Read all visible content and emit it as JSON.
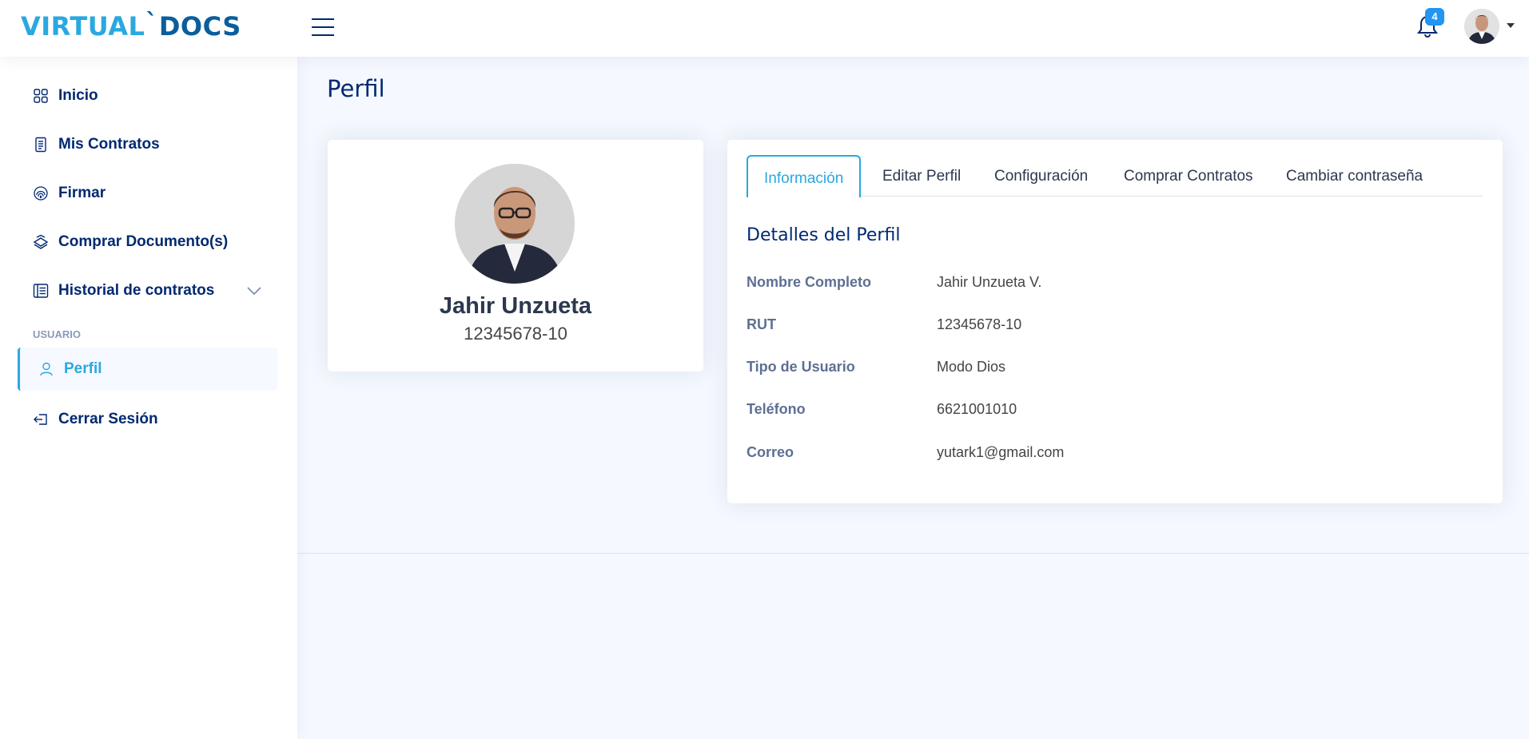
{
  "header": {
    "logo_part1": "VIRTUAL",
    "logo_tick": "`",
    "logo_part2": "DOCS",
    "notification_count": "4",
    "menu_icon": "hamburger-icon",
    "bell_icon": "bell-icon"
  },
  "sidebar": {
    "items": [
      {
        "label": "Inicio",
        "icon": "grid-icon"
      },
      {
        "label": "Mis Contratos",
        "icon": "document-icon"
      },
      {
        "label": "Firmar",
        "icon": "fingerprint-icon"
      },
      {
        "label": "Comprar Documento(s)",
        "icon": "stack-icon"
      },
      {
        "label": "Historial de contratos",
        "icon": "list-icon"
      }
    ],
    "heading": "USUARIO",
    "profile_label": "Perfil",
    "logout_label": "Cerrar Sesión"
  },
  "page": {
    "title": "Perfil"
  },
  "profile_card": {
    "name": "Jahir Unzueta",
    "rut": "12345678-10"
  },
  "tabs": [
    {
      "label": "Información",
      "active": true
    },
    {
      "label": "Editar Perfil",
      "active": false
    },
    {
      "label": "Configuración",
      "active": false
    },
    {
      "label": "Comprar Contratos",
      "active": false
    },
    {
      "label": "Cambiar contraseña",
      "active": false
    }
  ],
  "details": {
    "title": "Detalles del Perfil",
    "rows": [
      {
        "label": "Nombre Completo",
        "value": "Jahir Unzueta V."
      },
      {
        "label": "RUT",
        "value": "12345678-10"
      },
      {
        "label": "Tipo de Usuario",
        "value": "Modo Dios"
      },
      {
        "label": "Teléfono",
        "value": "6621001010"
      },
      {
        "label": "Correo",
        "value": "yutark1@gmail.com"
      }
    ]
  },
  "colors": {
    "accent": "#2aa8e0",
    "navy": "#012970",
    "background": "#f5f8fe"
  }
}
